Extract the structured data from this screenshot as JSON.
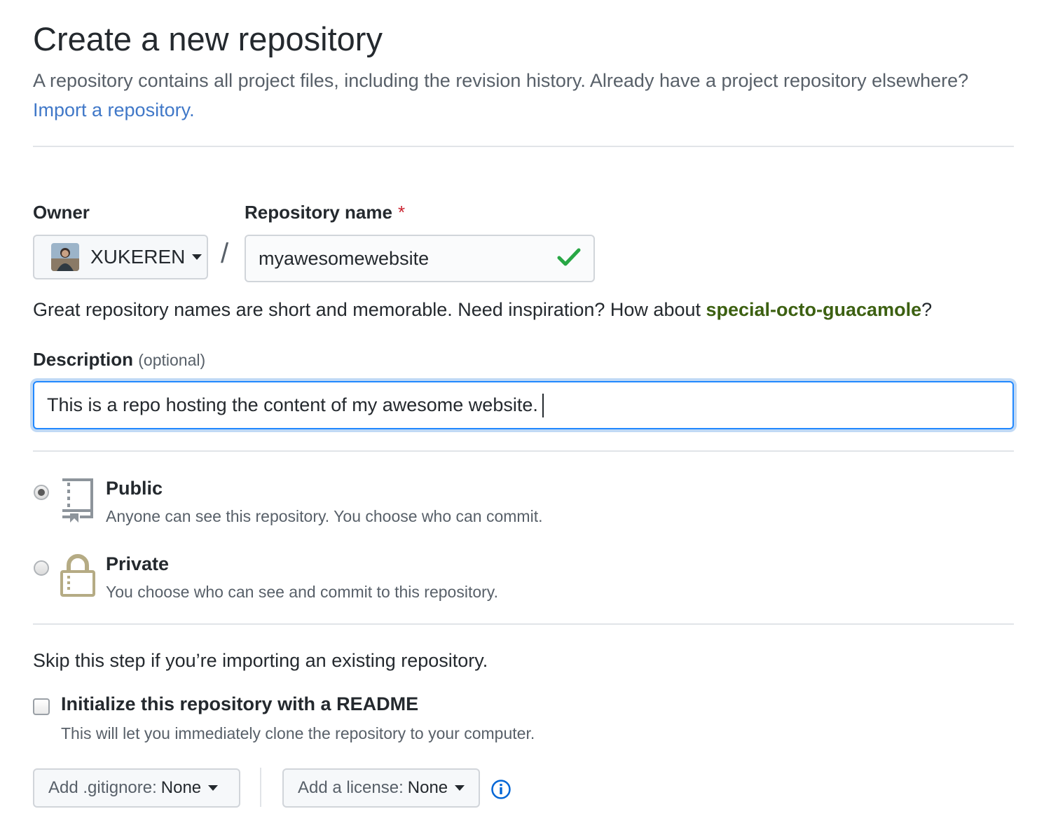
{
  "page": {
    "title": "Create a new repository",
    "subtitle": "A repository contains all project files, including the revision history. Already have a project repository elsewhere?",
    "import_link": "Import a repository."
  },
  "owner": {
    "label": "Owner",
    "name": "XUKEREN",
    "avatar_icon": "user-avatar"
  },
  "repo": {
    "label": "Repository name",
    "required_mark": "*",
    "separator": "/",
    "value": "myawesomewebsite",
    "valid_icon": "check-icon",
    "valid_color": "#28a745"
  },
  "hint": {
    "text": "Great repository names are short and memorable. Need inspiration? How about ",
    "suggestion": "special-octo-guacamole",
    "suffix": "?"
  },
  "description": {
    "label": "Description",
    "optional": "(optional)",
    "value": "This is a repo hosting the content of my awesome website."
  },
  "visibility": {
    "selected": "public",
    "public": {
      "title": "Public",
      "desc": "Anyone can see this repository. You choose who can commit.",
      "icon": "repo-book-icon"
    },
    "private": {
      "title": "Private",
      "desc": "You choose who can see and commit to this repository.",
      "icon": "lock-icon"
    }
  },
  "init": {
    "skip_text": "Skip this step if you’re importing an existing repository.",
    "readme_label": "Initialize this repository with a README",
    "readme_desc": "This will let you immediately clone the repository to your computer.",
    "readme_checked": false
  },
  "gitignore": {
    "prefix": "Add .gitignore:",
    "value": "None"
  },
  "license": {
    "prefix": "Add a license:",
    "value": "None",
    "info_icon": "info-icon"
  },
  "colors": {
    "link": "#4078c8",
    "suggestion": "#3c6011",
    "focus": "#2188ff",
    "lock": "#b5ab84"
  }
}
